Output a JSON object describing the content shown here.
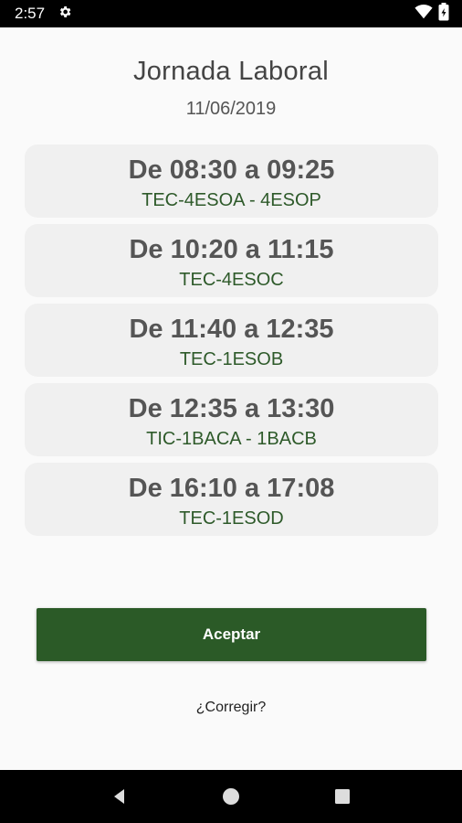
{
  "status_bar": {
    "time": "2:57",
    "icons": [
      "settings-icon",
      "wifi-icon",
      "battery-icon"
    ]
  },
  "header": {
    "title": "Jornada Laboral",
    "date": "11/06/2019"
  },
  "slots": [
    {
      "time": "De 08:30 a 09:25",
      "group": "TEC-4ESOA - 4ESOP"
    },
    {
      "time": "De 10:20 a 11:15",
      "group": "TEC-4ESOC"
    },
    {
      "time": "De 11:40 a 12:35",
      "group": "TEC-1ESOB"
    },
    {
      "time": "De 12:35 a 13:30",
      "group": "TIC-1BACA - 1BACB"
    },
    {
      "time": "De 16:10 a 17:08",
      "group": "TEC-1ESOD"
    }
  ],
  "actions": {
    "accept_label": "Aceptar",
    "correct_label": "¿Corregir?"
  },
  "colors": {
    "accent": "#2b5a27",
    "group_text": "#2e5a2a",
    "card_bg": "#f0f0f0"
  },
  "nav_bar": {
    "icons": [
      "back-icon",
      "home-icon",
      "recents-icon"
    ]
  }
}
